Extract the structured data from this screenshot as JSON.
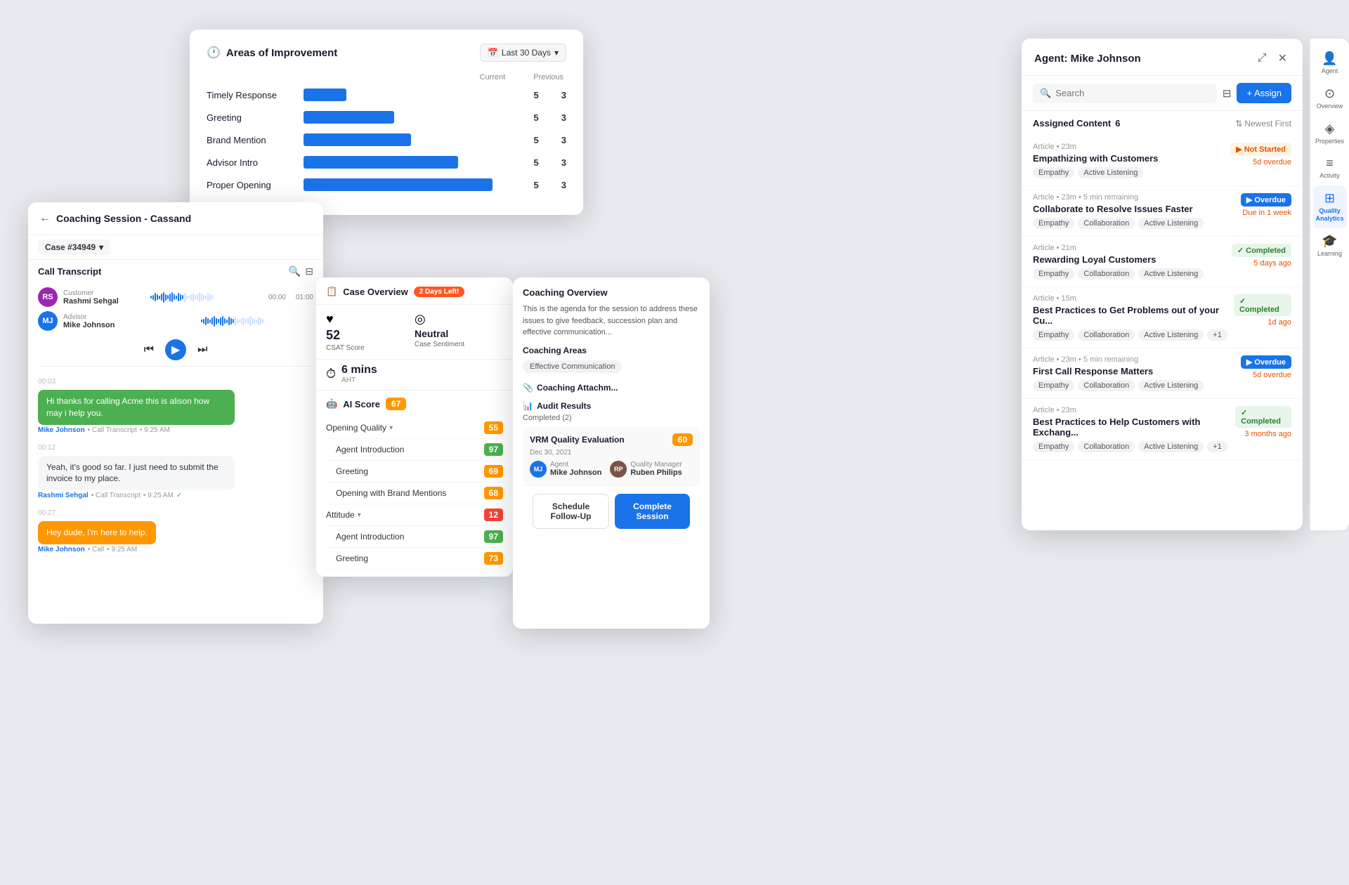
{
  "areas_card": {
    "title": "Areas of Improvement",
    "date_range": "Last 30 Days",
    "col_current": "Current",
    "col_previous": "Previous",
    "rows": [
      {
        "label": "Timely Response",
        "bar_pct": 20,
        "current": 5,
        "previous": 3
      },
      {
        "label": "Greeting",
        "bar_pct": 42,
        "current": 5,
        "previous": 3
      },
      {
        "label": "Brand Mention",
        "bar_pct": 50,
        "current": 5,
        "previous": 3
      },
      {
        "label": "Advisor Intro",
        "bar_pct": 72,
        "current": 5,
        "previous": 3
      },
      {
        "label": "Proper Opening",
        "bar_pct": 88,
        "current": 5,
        "previous": 3
      }
    ]
  },
  "agent_panel": {
    "title": "Agent: Mike Johnson",
    "search_placeholder": "Search",
    "assign_label": "+ Assign",
    "assigned_content_label": "Assigned Content",
    "assigned_count": "6",
    "sort_label": "Newest First",
    "items": [
      {
        "type": "Article",
        "read_time": "23m",
        "status": "Not Started",
        "status_class": "badge-not-started",
        "time_info": "5d overdue",
        "title": "Empathizing with Customers",
        "tags": [
          "Empathy",
          "Active Listening"
        ]
      },
      {
        "type": "Article",
        "read_time": "23m • 5 min remaining",
        "status": "Overdue",
        "status_class": "badge-overdue",
        "time_info": "Due in 1 week",
        "title": "Collaborate to Resolve Issues Faster",
        "tags": [
          "Empathy",
          "Collaboration",
          "Active Listening"
        ]
      },
      {
        "type": "Article",
        "read_time": "21m",
        "status": "Completed",
        "status_class": "badge-completed",
        "time_info": "5 days ago",
        "title": "Rewarding Loyal Customers",
        "tags": [
          "Empathy",
          "Collaboration",
          "Active Listening"
        ]
      },
      {
        "type": "Article",
        "read_time": "15m",
        "status": "Completed",
        "status_class": "badge-completed",
        "time_info": "1d ago",
        "title": "Best Practices to Get Problems out of your Cu...",
        "tags": [
          "Empathy",
          "Collaboration",
          "Active Listening",
          "+1"
        ]
      },
      {
        "type": "Article",
        "read_time": "23m • 5 min remaining",
        "status": "Overdue",
        "status_class": "badge-overdue",
        "time_info": "5d overdue",
        "title": "First Call Response Matters",
        "tags": [
          "Empathy",
          "Collaboration",
          "Active Listening"
        ]
      },
      {
        "type": "Article",
        "read_time": "23m",
        "status": "Completed",
        "status_class": "badge-completed",
        "time_info": "3 months ago",
        "title": "Best Practices to Help Customers with Exchang...",
        "tags": [
          "Empathy",
          "Collaboration",
          "Active Listening",
          "+1"
        ]
      }
    ]
  },
  "sidebar": {
    "items": [
      {
        "label": "Agent",
        "icon": "👤",
        "active": false
      },
      {
        "label": "Overview",
        "icon": "⊙",
        "active": false
      },
      {
        "label": "Properties",
        "icon": "◈",
        "active": false
      },
      {
        "label": "Activity",
        "icon": "≡",
        "active": false
      },
      {
        "label": "Quality Analytics",
        "icon": "⊞",
        "active": true
      },
      {
        "label": "Learning",
        "icon": "🎓",
        "active": false
      }
    ]
  },
  "coaching_card": {
    "title": "Coaching Session - Cassand",
    "case_number": "Case #34949",
    "call_transcript_title": "Call Transcript",
    "customer_name": "Rashmi Sehgal",
    "advisor_name": "Mike Johnson",
    "messages": [
      {
        "text": "Hi thanks for calling Acme this is alison how may i help you.",
        "style": "green",
        "sender": "Mike Johnson",
        "role": "Call Transcript",
        "time": "9:25 AM",
        "timestamp": "00:03"
      },
      {
        "text": "Yeah, it's good so far. I just need to submit the invoice to my place.",
        "style": "white",
        "sender": "Rashmi Sehgal",
        "role": "Call Transcript",
        "time": "9:25 AM",
        "timestamp": "00:12",
        "verified": true
      },
      {
        "text": "Hey dude, I'm here to help.",
        "style": "orange",
        "sender": "Mike Johnson",
        "role": "Call",
        "time": "9:25 AM",
        "timestamp": "00:27"
      }
    ]
  },
  "case_overview": {
    "title": "Case Overview",
    "days_left": "2 Days Left!",
    "csat_label": "CSAT Score",
    "csat_value": "52",
    "sentiment_label": "Case Sentiment",
    "sentiment_value": "Neutral",
    "aht_label": "AHT",
    "aht_value": "6 mins"
  },
  "ai_score": {
    "title": "AI Score",
    "score": "67",
    "categories": [
      {
        "label": "Opening Quality",
        "expandable": true,
        "score": "55",
        "color": "score-yellow",
        "sub_items": [
          {
            "label": "Agent Introduction",
            "score": "97",
            "color": "score-green"
          },
          {
            "label": "Greeting",
            "score": "69",
            "color": "score-yellow"
          },
          {
            "label": "Opening with Brand Mentions",
            "score": "68",
            "color": "score-yellow"
          }
        ]
      },
      {
        "label": "Attitude",
        "expandable": true,
        "score": "12",
        "color": "score-red",
        "sub_items": [
          {
            "label": "Agent Introduction",
            "score": "97",
            "color": "score-green"
          },
          {
            "label": "Greeting",
            "score": "73",
            "color": "score-yellow"
          }
        ]
      }
    ]
  },
  "coaching_overview": {
    "title": "Coaching Overview",
    "text": "This is the agenda for the session to address these issues to give feedback, succession plan and effective communication...",
    "areas_title": "Coaching Areas",
    "areas": [
      "Effective Communication"
    ],
    "attachment_title": "Coaching Attachm...",
    "audit_title": "Audit Results",
    "audit_completed_label": "Completed (2)",
    "audit_items": [
      {
        "name": "VRM Quality Evaluation",
        "date": "Dec 30, 2021",
        "score": "60",
        "agent_role": "Agent",
        "agent_name": "Mike Johnson",
        "manager_role": "Quality Manager",
        "manager_name": "Ruben Philips"
      }
    ],
    "schedule_label": "Schedule Follow-Up",
    "complete_label": "Complete Session"
  }
}
